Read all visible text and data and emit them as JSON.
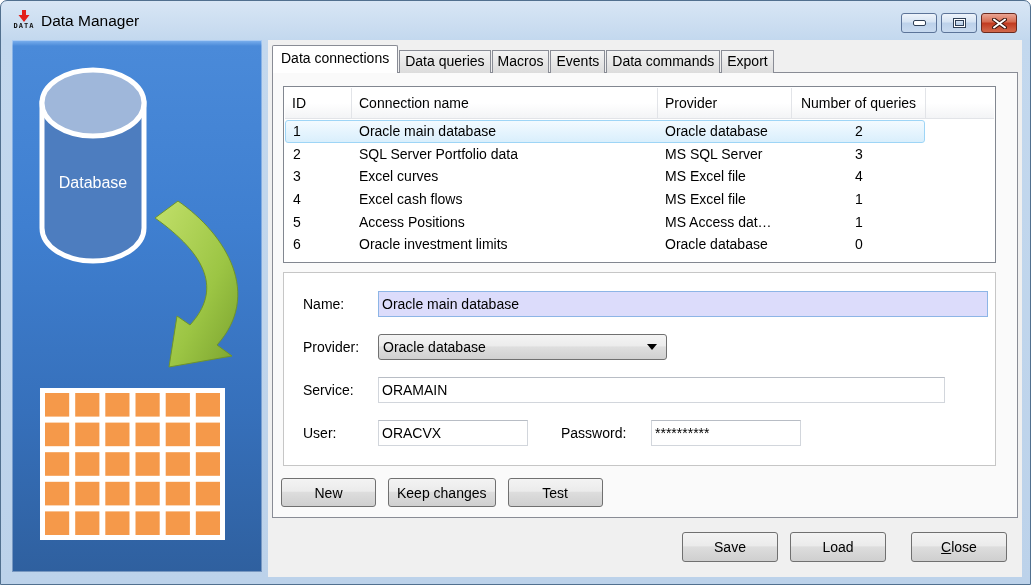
{
  "window": {
    "icon_label": "DATA",
    "title": "Data Manager"
  },
  "sidebar": {
    "illustration_label": "Database"
  },
  "tabs": [
    {
      "label": "Data connections",
      "selected": true
    },
    {
      "label": "Data queries",
      "selected": false
    },
    {
      "label": "Macros",
      "selected": false
    },
    {
      "label": "Events",
      "selected": false
    },
    {
      "label": "Data commands",
      "selected": false
    },
    {
      "label": "Export",
      "selected": false
    }
  ],
  "table": {
    "columns": [
      "ID",
      "Connection name",
      "Provider",
      "Number of queries"
    ],
    "rows": [
      {
        "cells": [
          "1",
          "Oracle main database",
          "Oracle database",
          "2"
        ],
        "selected": true
      },
      {
        "cells": [
          "2",
          "SQL Server Portfolio data",
          "MS SQL Server",
          "3"
        ],
        "selected": false
      },
      {
        "cells": [
          "3",
          "Excel curves",
          "MS Excel file",
          "4"
        ],
        "selected": false
      },
      {
        "cells": [
          "4",
          "Excel cash flows",
          "MS Excel file",
          "1"
        ],
        "selected": false
      },
      {
        "cells": [
          "5",
          "Access Positions",
          "MS Access dat…",
          "1"
        ],
        "selected": false
      },
      {
        "cells": [
          "6",
          "Oracle investment limits",
          "Oracle database",
          "0"
        ],
        "selected": false
      }
    ]
  },
  "form": {
    "rows": [
      {
        "fields": [
          {
            "kind": "text",
            "label": "Name:",
            "value": "Oracle main database",
            "focused": true
          }
        ]
      },
      {
        "fields": [
          {
            "kind": "dropdown",
            "label": "Provider:",
            "value": "Oracle database"
          }
        ]
      },
      {
        "fields": [
          {
            "kind": "text",
            "label": "Service:",
            "value": "ORAMAIN",
            "focused": false
          }
        ]
      },
      {
        "fields": [
          {
            "kind": "text",
            "label": "User:",
            "value": "ORACVX",
            "focused": false
          },
          {
            "kind": "text",
            "label": "Password:",
            "value": "**********",
            "focused": false
          }
        ]
      }
    ]
  },
  "form_buttons": [
    "New",
    "Keep changes",
    "Test"
  ],
  "dialog_buttons": [
    {
      "label": "Save",
      "access_key": false
    },
    {
      "label": "Load",
      "access_key": false
    },
    {
      "label": "Close",
      "access_key": true
    }
  ]
}
